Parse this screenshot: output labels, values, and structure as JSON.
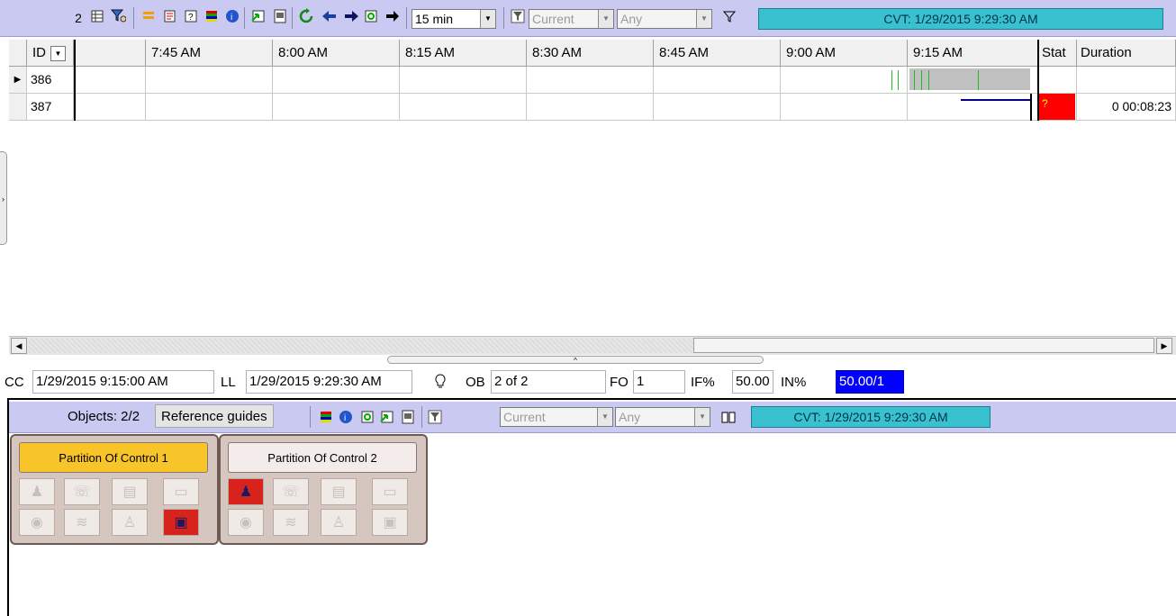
{
  "toolbar": {
    "count": "2",
    "interval": "15 min",
    "scope": "Current",
    "filter": "Any",
    "cvt": "CVT: 1/29/2015 9:29:30 AM"
  },
  "grid": {
    "id_header": "ID",
    "time_columns": [
      "7:45 AM",
      "8:00 AM",
      "8:15 AM",
      "8:30 AM",
      "8:45 AM",
      "9:00 AM",
      "9:15 AM"
    ],
    "stat_header": "Stat",
    "duration_header": "Duration",
    "rows": [
      {
        "id": "386",
        "stat": "",
        "duration": ""
      },
      {
        "id": "387",
        "stat": "?",
        "duration": "0 00:08:23"
      }
    ]
  },
  "status": {
    "cc_label": "CC",
    "cc_value": "1/29/2015 9:15:00 AM",
    "ll_label": "LL",
    "ll_value": "1/29/2015 9:29:30 AM",
    "ob_label": "OB",
    "ob_value": "2 of 2",
    "fo_label": "FO",
    "fo_value": "1",
    "if_label": "IF%",
    "if_value": "50.00",
    "in_label": "IN%",
    "in_value": "50.00/1"
  },
  "lower": {
    "objects_label": "Objects: 2/2",
    "reference_guides": "Reference guides",
    "scope": "Current",
    "filter": "Any",
    "cvt": "CVT: 1/29/2015 9:29:30 AM"
  },
  "partitions": [
    {
      "title": "Partition  Of Control 1",
      "title_color": "#f7c42a",
      "active_index": 7
    },
    {
      "title": "Partition  Of Control 2",
      "title_color": "#f3ecea",
      "active_index": 0
    }
  ],
  "colors": {
    "toolbar_bg": "#c9c9f2",
    "cvt_bg": "#39c1cf",
    "in_highlight": "#0000ff",
    "stat_alert": "#ff0000",
    "event_green": "#22bb22",
    "duration_line": "#00008b"
  }
}
